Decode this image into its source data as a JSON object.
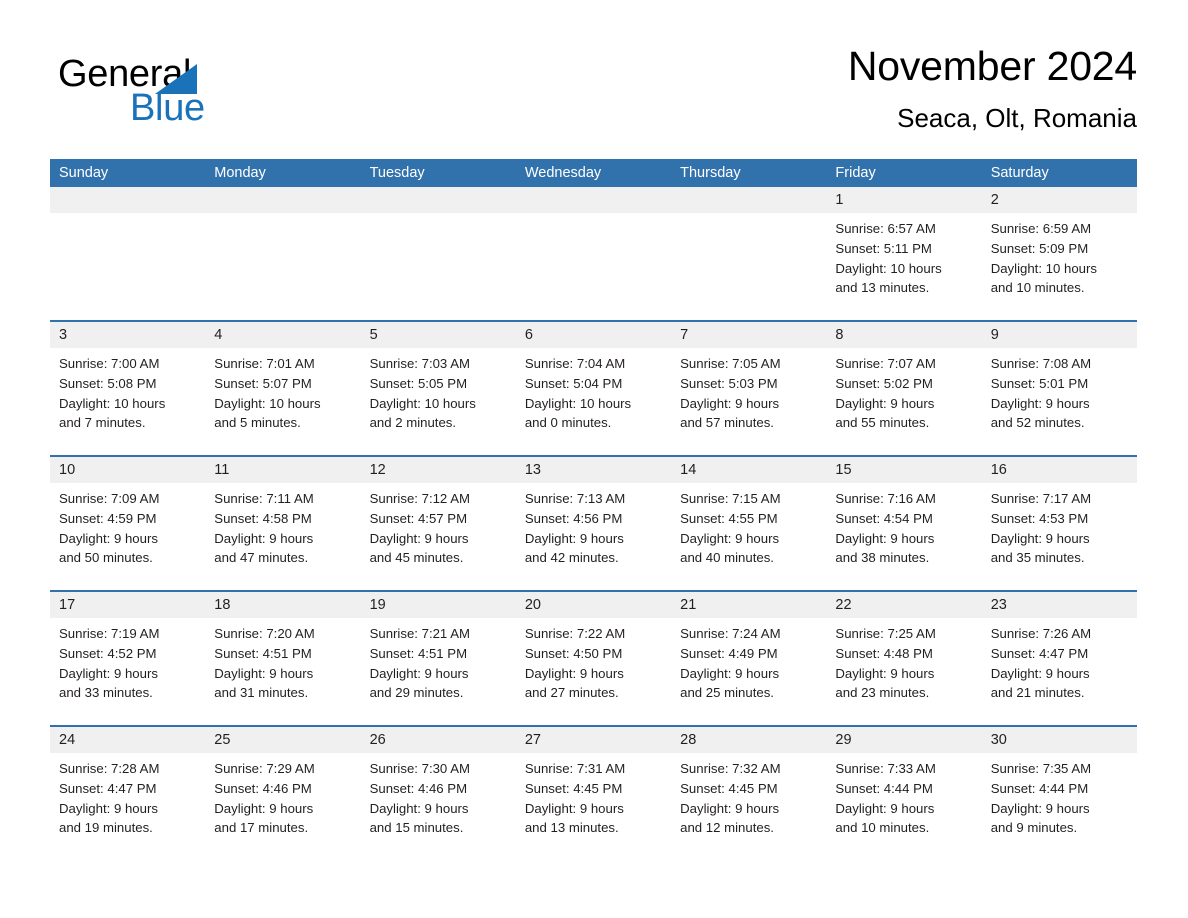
{
  "brand": {
    "name_part1": "General",
    "name_part2": "Blue",
    "accent_color": "#1a72b8"
  },
  "header": {
    "title": "November 2024",
    "location": "Seaca, Olt, Romania"
  },
  "theme": {
    "header_blue": "#3272ac",
    "date_band_gray": "#f0f0f0",
    "text_color": "#231f20"
  },
  "weekdays": [
    "Sunday",
    "Monday",
    "Tuesday",
    "Wednesday",
    "Thursday",
    "Friday",
    "Saturday"
  ],
  "weeks": [
    [
      {
        "day": "",
        "sunrise": "",
        "sunset": "",
        "daylight1": "",
        "daylight2": ""
      },
      {
        "day": "",
        "sunrise": "",
        "sunset": "",
        "daylight1": "",
        "daylight2": ""
      },
      {
        "day": "",
        "sunrise": "",
        "sunset": "",
        "daylight1": "",
        "daylight2": ""
      },
      {
        "day": "",
        "sunrise": "",
        "sunset": "",
        "daylight1": "",
        "daylight2": ""
      },
      {
        "day": "",
        "sunrise": "",
        "sunset": "",
        "daylight1": "",
        "daylight2": ""
      },
      {
        "day": "1",
        "sunrise": "Sunrise: 6:57 AM",
        "sunset": "Sunset: 5:11 PM",
        "daylight1": "Daylight: 10 hours",
        "daylight2": "and 13 minutes."
      },
      {
        "day": "2",
        "sunrise": "Sunrise: 6:59 AM",
        "sunset": "Sunset: 5:09 PM",
        "daylight1": "Daylight: 10 hours",
        "daylight2": "and 10 minutes."
      }
    ],
    [
      {
        "day": "3",
        "sunrise": "Sunrise: 7:00 AM",
        "sunset": "Sunset: 5:08 PM",
        "daylight1": "Daylight: 10 hours",
        "daylight2": "and 7 minutes."
      },
      {
        "day": "4",
        "sunrise": "Sunrise: 7:01 AM",
        "sunset": "Sunset: 5:07 PM",
        "daylight1": "Daylight: 10 hours",
        "daylight2": "and 5 minutes."
      },
      {
        "day": "5",
        "sunrise": "Sunrise: 7:03 AM",
        "sunset": "Sunset: 5:05 PM",
        "daylight1": "Daylight: 10 hours",
        "daylight2": "and 2 minutes."
      },
      {
        "day": "6",
        "sunrise": "Sunrise: 7:04 AM",
        "sunset": "Sunset: 5:04 PM",
        "daylight1": "Daylight: 10 hours",
        "daylight2": "and 0 minutes."
      },
      {
        "day": "7",
        "sunrise": "Sunrise: 7:05 AM",
        "sunset": "Sunset: 5:03 PM",
        "daylight1": "Daylight: 9 hours",
        "daylight2": "and 57 minutes."
      },
      {
        "day": "8",
        "sunrise": "Sunrise: 7:07 AM",
        "sunset": "Sunset: 5:02 PM",
        "daylight1": "Daylight: 9 hours",
        "daylight2": "and 55 minutes."
      },
      {
        "day": "9",
        "sunrise": "Sunrise: 7:08 AM",
        "sunset": "Sunset: 5:01 PM",
        "daylight1": "Daylight: 9 hours",
        "daylight2": "and 52 minutes."
      }
    ],
    [
      {
        "day": "10",
        "sunrise": "Sunrise: 7:09 AM",
        "sunset": "Sunset: 4:59 PM",
        "daylight1": "Daylight: 9 hours",
        "daylight2": "and 50 minutes."
      },
      {
        "day": "11",
        "sunrise": "Sunrise: 7:11 AM",
        "sunset": "Sunset: 4:58 PM",
        "daylight1": "Daylight: 9 hours",
        "daylight2": "and 47 minutes."
      },
      {
        "day": "12",
        "sunrise": "Sunrise: 7:12 AM",
        "sunset": "Sunset: 4:57 PM",
        "daylight1": "Daylight: 9 hours",
        "daylight2": "and 45 minutes."
      },
      {
        "day": "13",
        "sunrise": "Sunrise: 7:13 AM",
        "sunset": "Sunset: 4:56 PM",
        "daylight1": "Daylight: 9 hours",
        "daylight2": "and 42 minutes."
      },
      {
        "day": "14",
        "sunrise": "Sunrise: 7:15 AM",
        "sunset": "Sunset: 4:55 PM",
        "daylight1": "Daylight: 9 hours",
        "daylight2": "and 40 minutes."
      },
      {
        "day": "15",
        "sunrise": "Sunrise: 7:16 AM",
        "sunset": "Sunset: 4:54 PM",
        "daylight1": "Daylight: 9 hours",
        "daylight2": "and 38 minutes."
      },
      {
        "day": "16",
        "sunrise": "Sunrise: 7:17 AM",
        "sunset": "Sunset: 4:53 PM",
        "daylight1": "Daylight: 9 hours",
        "daylight2": "and 35 minutes."
      }
    ],
    [
      {
        "day": "17",
        "sunrise": "Sunrise: 7:19 AM",
        "sunset": "Sunset: 4:52 PM",
        "daylight1": "Daylight: 9 hours",
        "daylight2": "and 33 minutes."
      },
      {
        "day": "18",
        "sunrise": "Sunrise: 7:20 AM",
        "sunset": "Sunset: 4:51 PM",
        "daylight1": "Daylight: 9 hours",
        "daylight2": "and 31 minutes."
      },
      {
        "day": "19",
        "sunrise": "Sunrise: 7:21 AM",
        "sunset": "Sunset: 4:51 PM",
        "daylight1": "Daylight: 9 hours",
        "daylight2": "and 29 minutes."
      },
      {
        "day": "20",
        "sunrise": "Sunrise: 7:22 AM",
        "sunset": "Sunset: 4:50 PM",
        "daylight1": "Daylight: 9 hours",
        "daylight2": "and 27 minutes."
      },
      {
        "day": "21",
        "sunrise": "Sunrise: 7:24 AM",
        "sunset": "Sunset: 4:49 PM",
        "daylight1": "Daylight: 9 hours",
        "daylight2": "and 25 minutes."
      },
      {
        "day": "22",
        "sunrise": "Sunrise: 7:25 AM",
        "sunset": "Sunset: 4:48 PM",
        "daylight1": "Daylight: 9 hours",
        "daylight2": "and 23 minutes."
      },
      {
        "day": "23",
        "sunrise": "Sunrise: 7:26 AM",
        "sunset": "Sunset: 4:47 PM",
        "daylight1": "Daylight: 9 hours",
        "daylight2": "and 21 minutes."
      }
    ],
    [
      {
        "day": "24",
        "sunrise": "Sunrise: 7:28 AM",
        "sunset": "Sunset: 4:47 PM",
        "daylight1": "Daylight: 9 hours",
        "daylight2": "and 19 minutes."
      },
      {
        "day": "25",
        "sunrise": "Sunrise: 7:29 AM",
        "sunset": "Sunset: 4:46 PM",
        "daylight1": "Daylight: 9 hours",
        "daylight2": "and 17 minutes."
      },
      {
        "day": "26",
        "sunrise": "Sunrise: 7:30 AM",
        "sunset": "Sunset: 4:46 PM",
        "daylight1": "Daylight: 9 hours",
        "daylight2": "and 15 minutes."
      },
      {
        "day": "27",
        "sunrise": "Sunrise: 7:31 AM",
        "sunset": "Sunset: 4:45 PM",
        "daylight1": "Daylight: 9 hours",
        "daylight2": "and 13 minutes."
      },
      {
        "day": "28",
        "sunrise": "Sunrise: 7:32 AM",
        "sunset": "Sunset: 4:45 PM",
        "daylight1": "Daylight: 9 hours",
        "daylight2": "and 12 minutes."
      },
      {
        "day": "29",
        "sunrise": "Sunrise: 7:33 AM",
        "sunset": "Sunset: 4:44 PM",
        "daylight1": "Daylight: 9 hours",
        "daylight2": "and 10 minutes."
      },
      {
        "day": "30",
        "sunrise": "Sunrise: 7:35 AM",
        "sunset": "Sunset: 4:44 PM",
        "daylight1": "Daylight: 9 hours",
        "daylight2": "and 9 minutes."
      }
    ]
  ]
}
